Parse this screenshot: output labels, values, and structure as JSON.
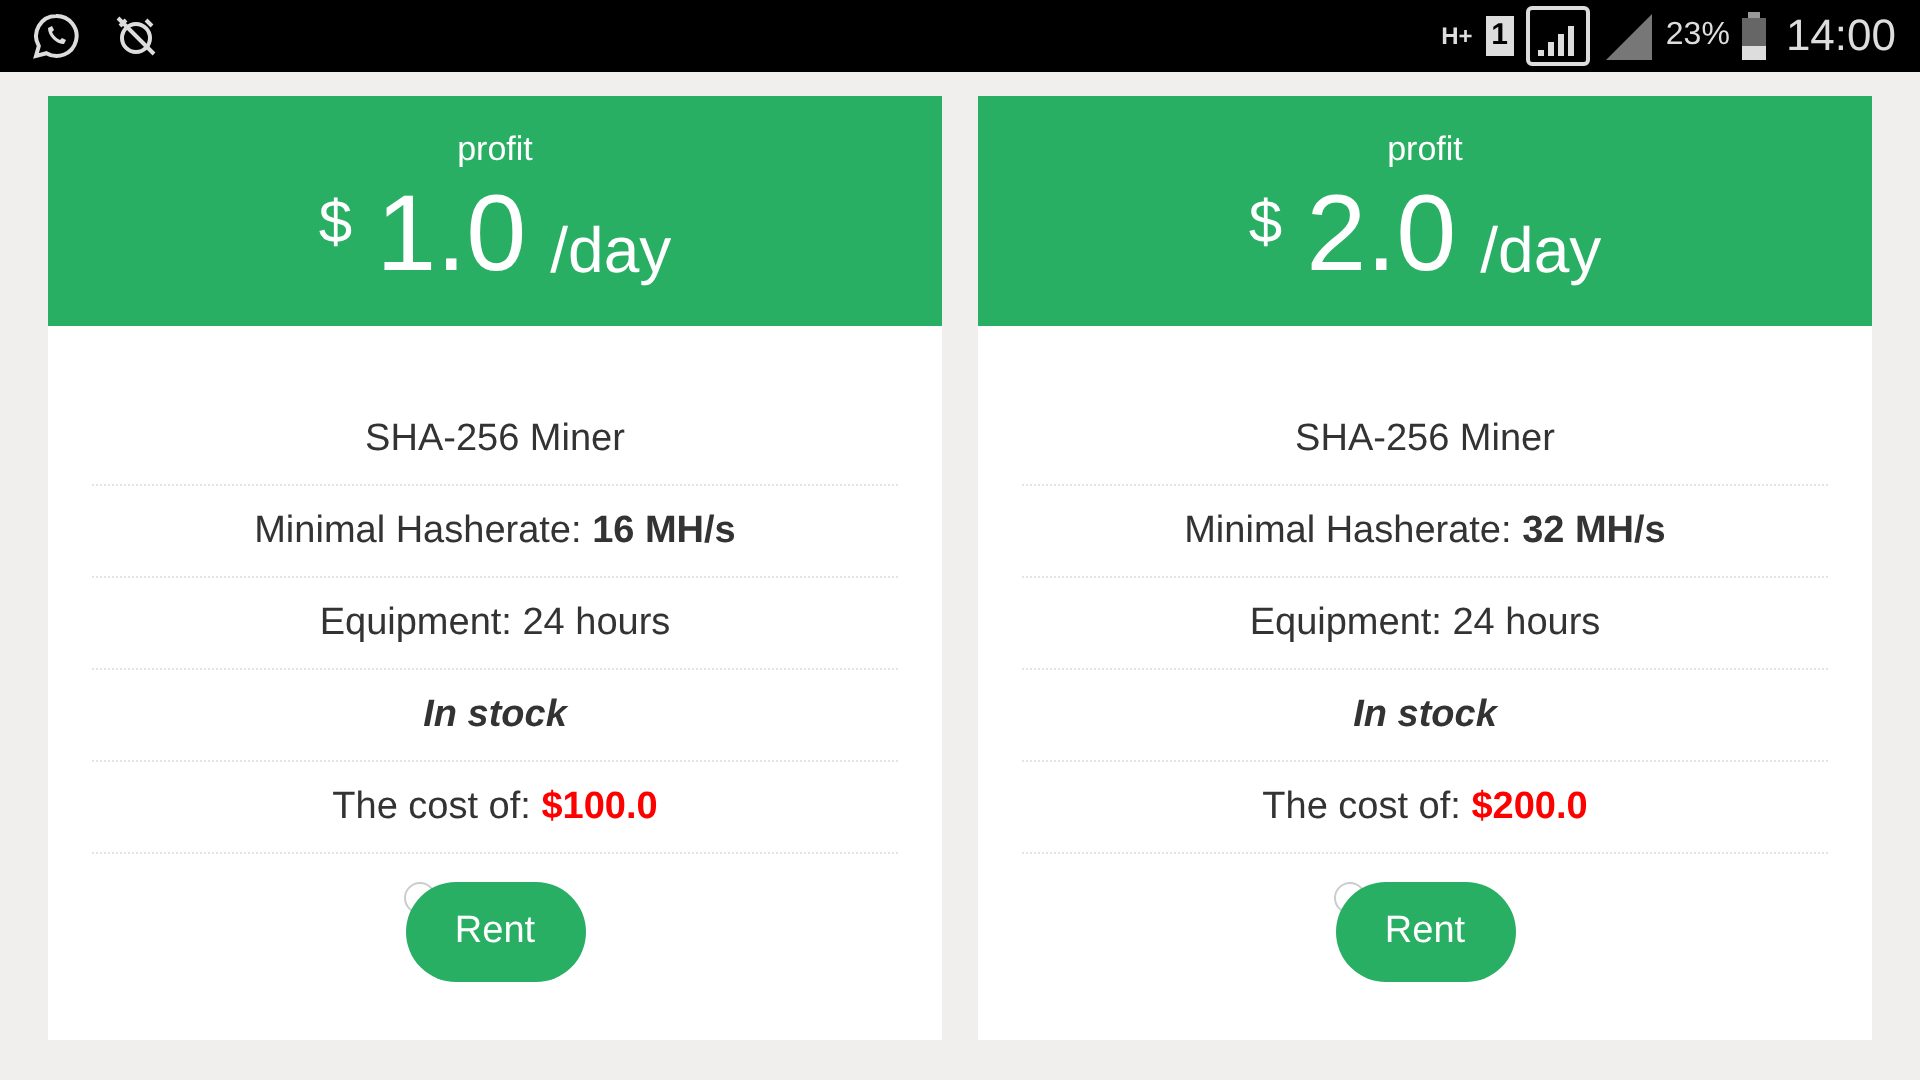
{
  "status_bar": {
    "network": "H+",
    "sim": "1",
    "battery": "23%",
    "time": "14:00"
  },
  "plans": [
    {
      "header_label": "profit",
      "currency": "$",
      "amount": "1.0",
      "unit": "/day",
      "rows": [
        {
          "kind": "plain",
          "label": "SHA-256 Miner"
        },
        {
          "kind": "spec",
          "label": "Minimal Hasherate:",
          "value": "16 MH/s"
        },
        {
          "kind": "plain",
          "label": "Equipment: 24 hours"
        },
        {
          "kind": "stock",
          "label": "In stock"
        },
        {
          "kind": "price",
          "label": "The cost of:",
          "value": "$100.0"
        }
      ],
      "button": "Rent"
    },
    {
      "header_label": "profit",
      "currency": "$",
      "amount": "2.0",
      "unit": "/day",
      "rows": [
        {
          "kind": "plain",
          "label": "SHA-256 Miner"
        },
        {
          "kind": "spec",
          "label": "Minimal Hasherate:",
          "value": "32 MH/s"
        },
        {
          "kind": "plain",
          "label": "Equipment: 24 hours"
        },
        {
          "kind": "stock",
          "label": "In stock"
        },
        {
          "kind": "price",
          "label": "The cost of:",
          "value": "$200.0"
        }
      ],
      "button": "Rent"
    }
  ]
}
